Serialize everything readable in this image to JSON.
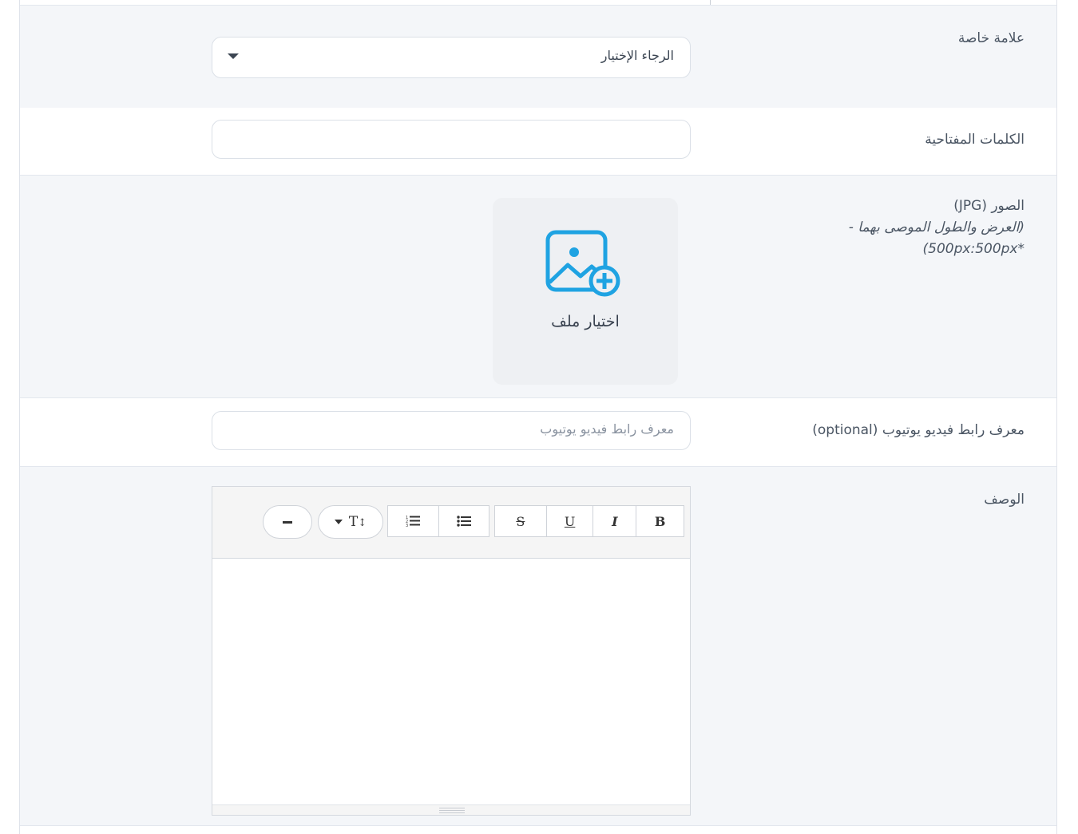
{
  "form": {
    "brand": {
      "label": "علامة خاصة",
      "selected": "الرجاء الإختيار"
    },
    "keywords": {
      "label": "الكلمات المفتاحية",
      "value": ""
    },
    "images": {
      "label": "الصور (JPG)",
      "hint_line1": "(العرض والطول الموصى بهما -",
      "hint_line2": "*500px:500px)",
      "upload_label": "اختيار ملف"
    },
    "youtube": {
      "label": "معرف رابط فيديو يوتيوب (optional)",
      "placeholder": "معرف رابط فيديو يوتيوب"
    },
    "description": {
      "label": "الوصف",
      "content": ""
    }
  },
  "toolbar": {
    "bold": "B",
    "italic": "I",
    "underline": "U",
    "strike": "S",
    "fontsize": "T"
  },
  "colors": {
    "accent": "#1fa3e2",
    "row_alt": "#f4f6f9"
  }
}
